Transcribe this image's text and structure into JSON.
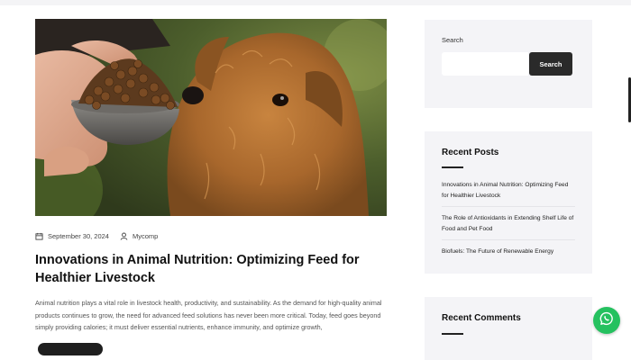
{
  "post": {
    "date": "September 30, 2024",
    "author": "Mycomp",
    "title": "Innovations in Animal Nutrition: Optimizing Feed for Healthier Livestock",
    "excerpt": "Animal nutrition plays a vital role in livestock health, productivity, and sustainability. As the demand for high-quality animal products continues to grow, the need for advanced feed solutions has never been more critical. Today, feed goes beyond simply providing calories; it must deliver essential nutrients, enhance immunity, and optimize growth,",
    "image_icon": "dog-eating-feed-photo",
    "date_icon": "calendar-icon",
    "author_icon": "user-icon"
  },
  "sidebar": {
    "search": {
      "label": "Search",
      "placeholder": "",
      "button": "Search"
    },
    "recent_posts": {
      "title": "Recent Posts",
      "items": [
        "Innovations in Animal Nutrition: Optimizing Feed for Healthier Livestock",
        "The Role of Antioxidants in Extending Shelf Life of Food and Pet Food",
        "Biofuels: The Future of Renewable Energy"
      ]
    },
    "recent_comments": {
      "title": "Recent Comments"
    }
  },
  "colors": {
    "whatsapp": "#25c15f",
    "widget_bg": "#f4f4f7",
    "button_dark": "#2a2a2a"
  }
}
